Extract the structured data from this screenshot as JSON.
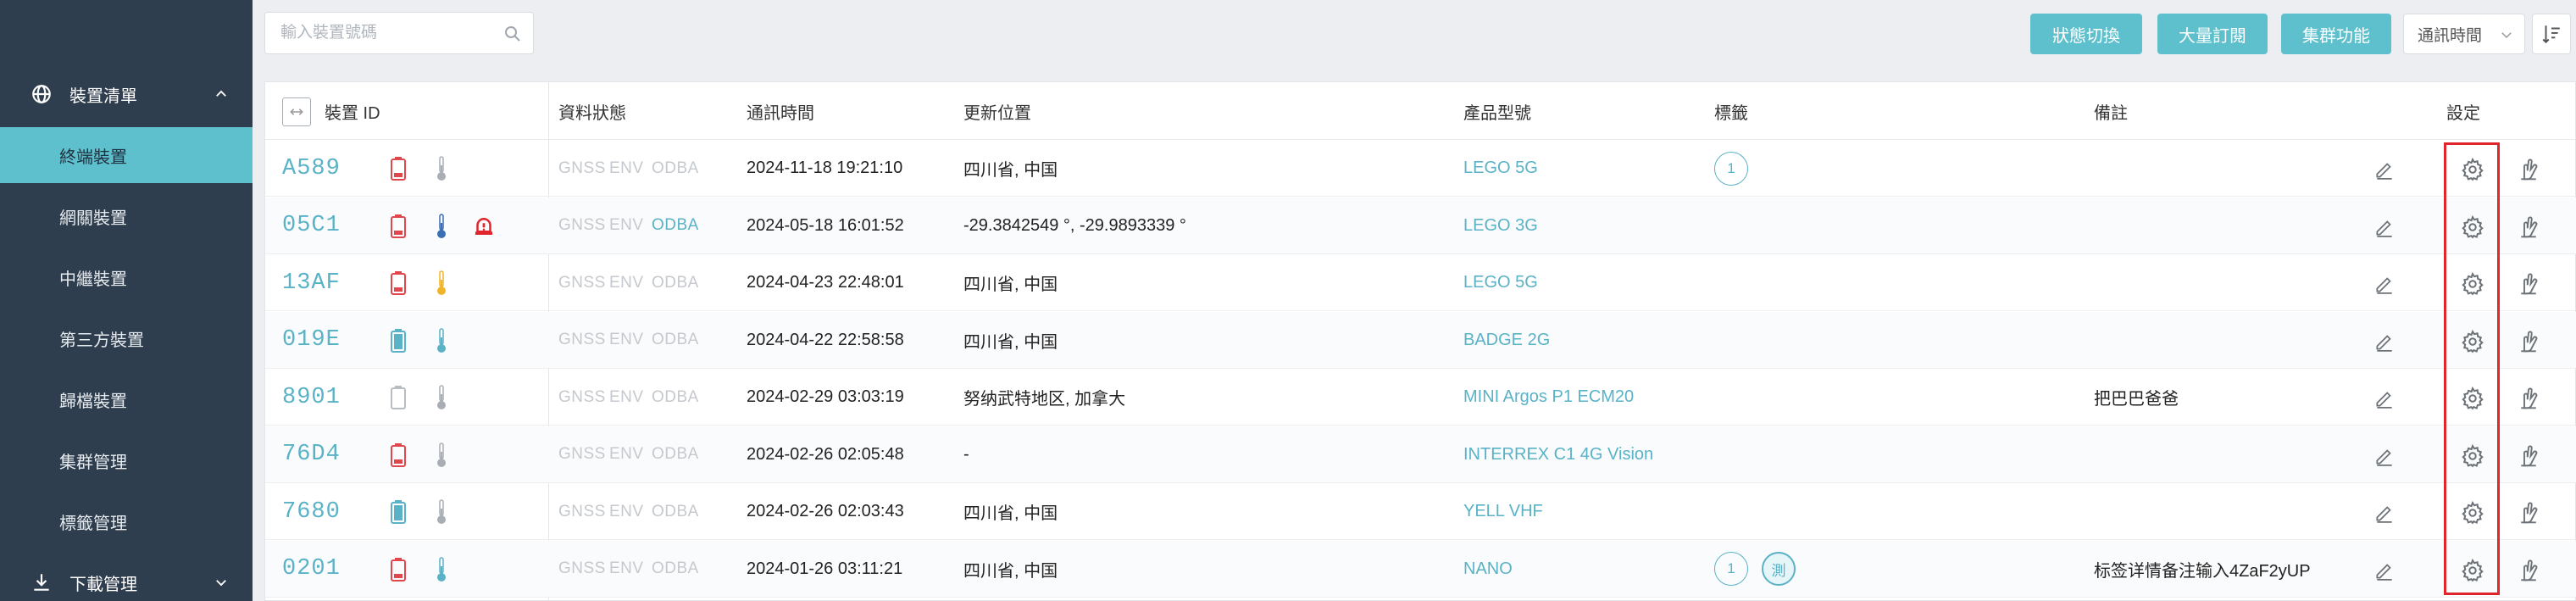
{
  "sidebar": {
    "header": "裝置清單",
    "items": [
      {
        "label": "終端裝置",
        "active": true
      },
      {
        "label": "網關裝置",
        "active": false
      },
      {
        "label": "中繼裝置",
        "active": false
      },
      {
        "label": "第三方裝置",
        "active": false
      },
      {
        "label": "歸檔裝置",
        "active": false
      },
      {
        "label": "集群管理",
        "active": false
      },
      {
        "label": "標籤管理",
        "active": false
      }
    ],
    "footer": "下載管理"
  },
  "toolbar": {
    "search_placeholder": "輸入裝置號碼",
    "btn_status": "狀態切換",
    "btn_subscribe": "大量訂閱",
    "btn_cluster": "集群功能",
    "sort_value": "通訊時間"
  },
  "table": {
    "headers": {
      "device_id": "裝置 ID",
      "data_status": "資料狀態",
      "comm_time": "通訊時間",
      "location": "更新位置",
      "model": "產品型號",
      "tags": "標籤",
      "remark": "備註",
      "settings": "設定"
    },
    "status_labels": [
      "GNSS",
      "ENV",
      "ODBA"
    ],
    "rows": [
      {
        "id": "A589",
        "battery": "red",
        "thermo": "gray",
        "alert": false,
        "odba_on": false,
        "time": "2024-11-18 19:21:10",
        "location": "四川省, 中国",
        "model": "LEGO 5G",
        "tags": [
          "1"
        ],
        "remark": ""
      },
      {
        "id": "05C1",
        "battery": "red",
        "thermo": "blue",
        "alert": true,
        "odba_on": true,
        "time": "2024-05-18 16:01:52",
        "location": "-29.3842549 °, -29.9893339 °",
        "model": "LEGO 3G",
        "tags": [],
        "remark": ""
      },
      {
        "id": "13AF",
        "battery": "red",
        "thermo": "yellow",
        "alert": false,
        "odba_on": false,
        "time": "2024-04-23 22:48:01",
        "location": "四川省, 中国",
        "model": "LEGO 5G",
        "tags": [],
        "remark": ""
      },
      {
        "id": "019E",
        "battery": "teal",
        "thermo": "teal",
        "alert": false,
        "odba_on": false,
        "time": "2024-04-22 22:58:58",
        "location": "四川省, 中国",
        "model": "BADGE 2G",
        "tags": [],
        "remark": ""
      },
      {
        "id": "8901",
        "battery": "empty",
        "thermo": "gray",
        "alert": false,
        "odba_on": false,
        "time": "2024-02-29 03:03:19",
        "location": "努纳武特地区, 加拿大",
        "model": "MINI Argos P1 ECM20",
        "tags": [],
        "remark": "把巴巴爸爸"
      },
      {
        "id": "76D4",
        "battery": "red",
        "thermo": "gray",
        "alert": false,
        "odba_on": false,
        "time": "2024-02-26 02:05:48",
        "location": "-",
        "model": "INTERREX C1 4G Vision",
        "tags": [],
        "remark": ""
      },
      {
        "id": "7680",
        "battery": "teal",
        "thermo": "gray",
        "alert": false,
        "odba_on": false,
        "time": "2024-02-26 02:03:43",
        "location": "四川省, 中国",
        "model": "YELL VHF",
        "tags": [],
        "remark": ""
      },
      {
        "id": "0201",
        "battery": "red",
        "thermo": "teal",
        "alert": false,
        "odba_on": false,
        "time": "2024-01-26 03:11:21",
        "location": "四川省, 中国",
        "model": "NANO",
        "tags": [
          "1",
          "測"
        ],
        "remark": "标签详情备注输入4ZaF2yUP"
      }
    ]
  },
  "colors": {
    "accent": "#5ec0cc",
    "sidebar_bg": "#2f3e4e",
    "battery_red": "#e0474c",
    "battery_teal": "#5ab2c7",
    "thermo_blue": "#3a6fb5",
    "thermo_yellow": "#f0b429",
    "alert_red": "#e0252c",
    "highlight_box": "#e0252c"
  }
}
